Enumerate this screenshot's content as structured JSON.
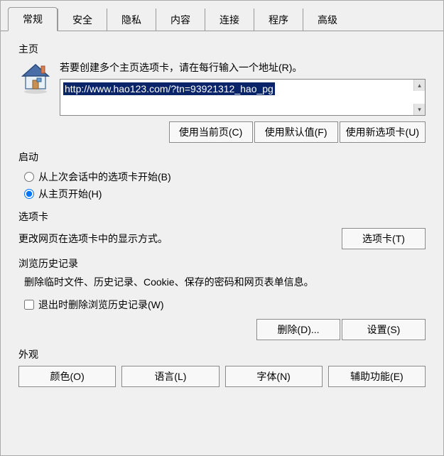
{
  "tabs": [
    "常规",
    "安全",
    "隐私",
    "内容",
    "连接",
    "程序",
    "高级"
  ],
  "activeTab": 0,
  "homepage": {
    "label": "主页",
    "hint": "若要创建多个主页选项卡，请在每行输入一个地址(R)。",
    "url": "http://www.hao123.com/?tn=93921312_hao_pg",
    "buttons": {
      "useCurrent": "使用当前页(C)",
      "useDefault": "使用默认值(F)",
      "useNewTab": "使用新选项卡(U)"
    }
  },
  "startup": {
    "label": "启动",
    "options": {
      "lastSession": "从上次会话中的选项卡开始(B)",
      "homepage": "从主页开始(H)"
    },
    "selected": "homepage"
  },
  "tabsSection": {
    "label": "选项卡",
    "desc": "更改网页在选项卡中的显示方式。",
    "button": "选项卡(T)"
  },
  "history": {
    "label": "浏览历史记录",
    "desc": "删除临时文件、历史记录、Cookie、保存的密码和网页表单信息。",
    "checkbox": "退出时删除浏览历史记录(W)",
    "checked": false,
    "buttons": {
      "delete": "删除(D)...",
      "settings": "设置(S)"
    }
  },
  "appearance": {
    "label": "外观",
    "buttons": {
      "colors": "颜色(O)",
      "languages": "语言(L)",
      "fonts": "字体(N)",
      "accessibility": "辅助功能(E)"
    }
  }
}
